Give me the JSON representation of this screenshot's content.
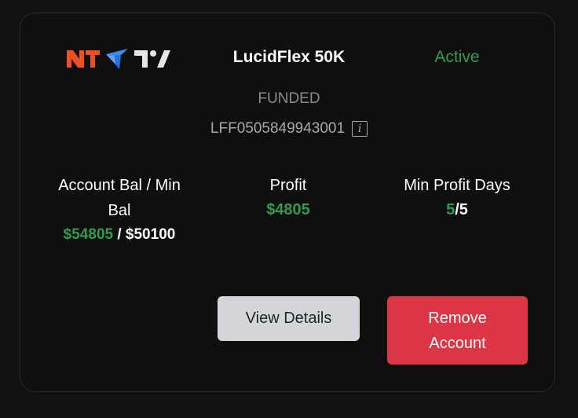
{
  "card": {
    "platform_logos": [
      "ninjatrader-logo",
      "tradovate-logo",
      "tradingview-logo"
    ],
    "title": "LucidFlex 50K",
    "status": "Active",
    "account_type": "FUNDED",
    "account_id": "LFF0505849943001",
    "info_icon": "info-icon"
  },
  "stats": {
    "balance": {
      "label": "Account Bal / Min Bal",
      "current": "$54805",
      "separator": " / ",
      "minimum": "$50100"
    },
    "profit": {
      "label": "Profit",
      "value": "$4805"
    },
    "min_profit_days": {
      "label": "Min Profit Days",
      "completed": "5",
      "required": "/5"
    }
  },
  "actions": {
    "view_details_label": "View Details",
    "remove_account_label": "Remove Account"
  },
  "colors": {
    "background": "#111111",
    "card_border": "#2c2c2c",
    "positive": "#2e9e4c",
    "muted_text": "#8a8a8a",
    "view_button": "#d3d5db",
    "remove_button": "#dc3545",
    "ninjatrader_brand": "#f04e23",
    "tradovate_brand": "#3b8cf4"
  }
}
